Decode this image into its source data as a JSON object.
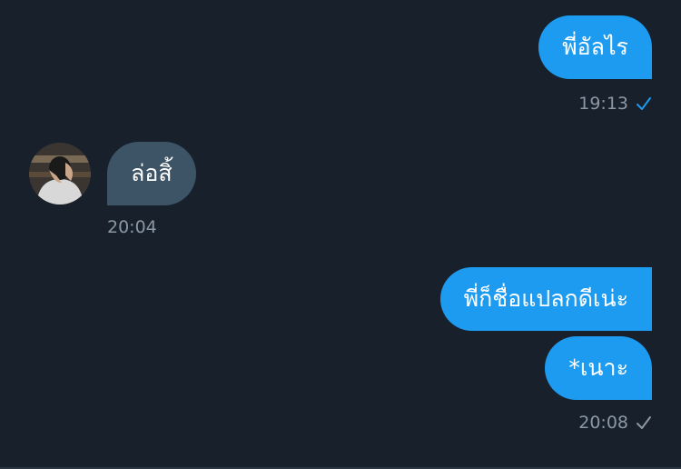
{
  "messages": [
    {
      "text": "พี่อัลไร",
      "time": "19:13",
      "status": "read"
    },
    {
      "text": "ล่อสิ้",
      "time": "20:04"
    },
    {
      "text": "พี่ก็ชื่อแปลกดีเน่ะ"
    },
    {
      "text": "*เนาะ",
      "time": "20:08",
      "status": "sent"
    }
  ],
  "colors": {
    "background": "#18202b",
    "outgoing_bubble": "#1d9bf0",
    "incoming_bubble": "#3d5466",
    "timestamp": "#8a98a5",
    "read_check": "#1d9bf0",
    "sent_check": "#8a98a5"
  },
  "icons": {
    "read": "check-icon",
    "sent": "check-icon"
  }
}
